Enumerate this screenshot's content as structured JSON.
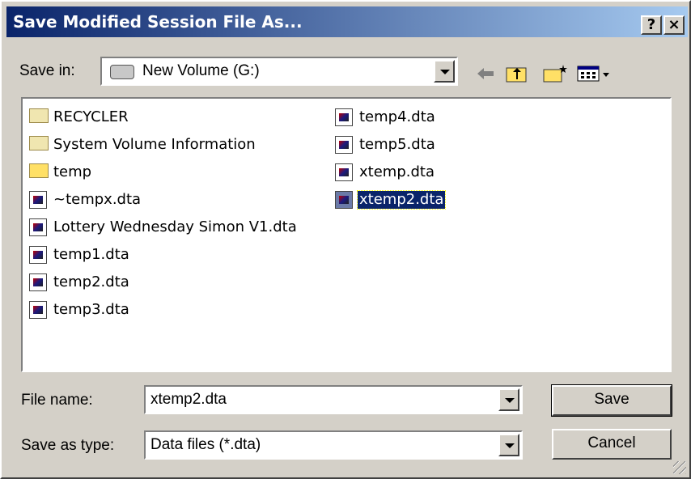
{
  "dialog": {
    "title": "Save Modified Session File As...",
    "help_label": "?",
    "close_label": "×"
  },
  "save_in": {
    "label": "Save in:",
    "value": "New Volume (G:)",
    "drive_icon": "drive-icon"
  },
  "toolbar": {
    "back_icon": "back-arrow-icon",
    "up_icon": "up-folder-icon",
    "new_folder_icon": "new-folder-icon",
    "view_icon": "view-menu-icon"
  },
  "files": {
    "column1": [
      {
        "name": "RECYCLER",
        "type": "folder"
      },
      {
        "name": "System Volume Information",
        "type": "folder"
      },
      {
        "name": "temp",
        "type": "folder-open"
      },
      {
        "name": "~tempx.dta",
        "type": "file"
      },
      {
        "name": "Lottery Wednesday Simon V1.dta",
        "type": "file"
      },
      {
        "name": "temp1.dta",
        "type": "file"
      },
      {
        "name": "temp2.dta",
        "type": "file"
      },
      {
        "name": "temp3.dta",
        "type": "file"
      }
    ],
    "column2": [
      {
        "name": "temp4.dta",
        "type": "file"
      },
      {
        "name": "temp5.dta",
        "type": "file"
      },
      {
        "name": "xtemp.dta",
        "type": "file"
      },
      {
        "name": "xtemp2.dta",
        "type": "file",
        "selected": true
      }
    ]
  },
  "file_name": {
    "label": "File name:",
    "value": "xtemp2.dta"
  },
  "save_type": {
    "label": "Save as type:",
    "value": "Data files (*.dta)"
  },
  "buttons": {
    "save": "Save",
    "cancel": "Cancel"
  },
  "colors": {
    "title_start": "#0a246a",
    "title_end": "#a6caf0",
    "face": "#d4d0c8",
    "selection": "#0a246a"
  }
}
